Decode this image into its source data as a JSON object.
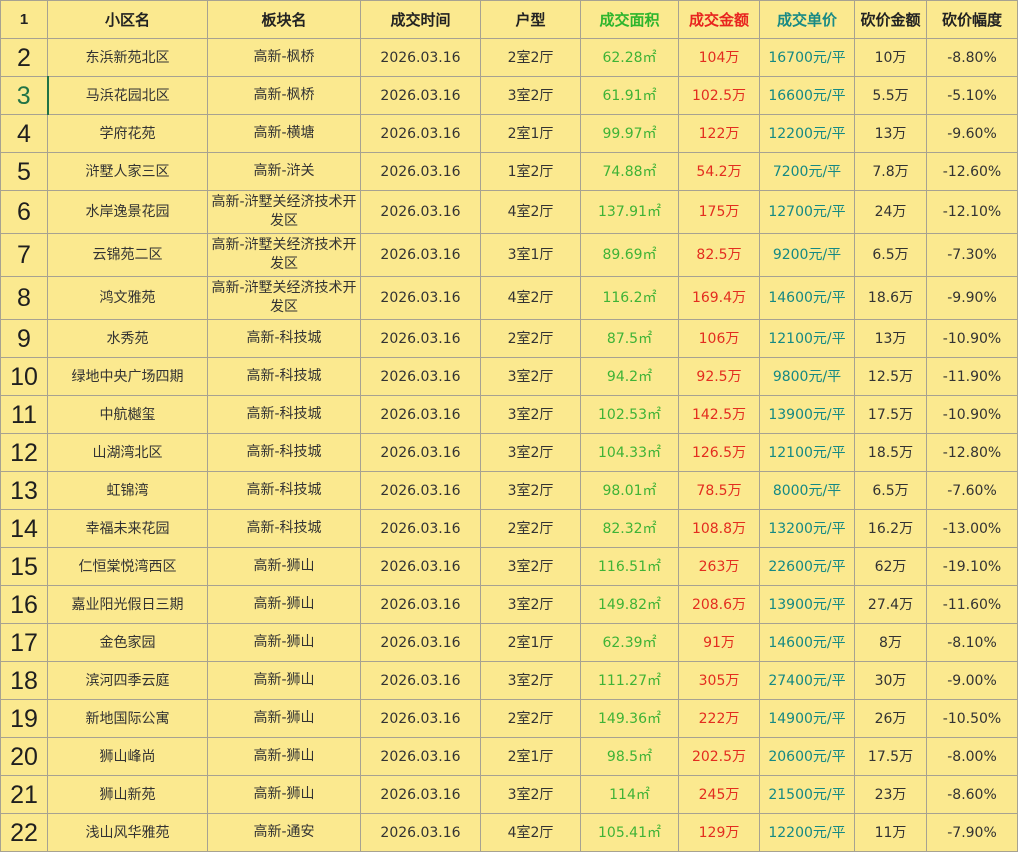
{
  "header": {
    "row_number": "1",
    "cols": [
      "小区名",
      "板块名",
      "成交时间",
      "户型",
      "成交面积",
      "成交金额",
      "成交单价",
      "砍价金额",
      "砍价幅度"
    ]
  },
  "colors": {
    "sheet_bg": "#fbe98f",
    "area_green": "#3fb336",
    "amount_red": "#e32d1f",
    "unit_teal": "#158984",
    "selection_green": "#217346"
  },
  "selected_row": "3",
  "rows": [
    {
      "n": "2",
      "name": "东浜新苑北区",
      "plate": "高新-枫桥",
      "date": "2026.03.16",
      "layout": "2室2厅",
      "area": "62.28㎡",
      "amount": "104万",
      "unit": "16700元/平",
      "cut": "10万",
      "pct": "-8.80%"
    },
    {
      "n": "3",
      "name": "马浜花园北区",
      "plate": "高新-枫桥",
      "date": "2026.03.16",
      "layout": "3室2厅",
      "area": "61.91㎡",
      "amount": "102.5万",
      "unit": "16600元/平",
      "cut": "5.5万",
      "pct": "-5.10%"
    },
    {
      "n": "4",
      "name": "学府花苑",
      "plate": "高新-横塘",
      "date": "2026.03.16",
      "layout": "2室1厅",
      "area": "99.97㎡",
      "amount": "122万",
      "unit": "12200元/平",
      "cut": "13万",
      "pct": "-9.60%"
    },
    {
      "n": "5",
      "name": "浒墅人家三区",
      "plate": "高新-浒关",
      "date": "2026.03.16",
      "layout": "1室2厅",
      "area": "74.88㎡",
      "amount": "54.2万",
      "unit": "7200元/平",
      "cut": "7.8万",
      "pct": "-12.60%"
    },
    {
      "n": "6",
      "name": "水岸逸景花园",
      "plate": "高新-浒墅关经济技术开发区",
      "date": "2026.03.16",
      "layout": "4室2厅",
      "area": "137.91㎡",
      "amount": "175万",
      "unit": "12700元/平",
      "cut": "24万",
      "pct": "-12.10%"
    },
    {
      "n": "7",
      "name": "云锦苑二区",
      "plate": "高新-浒墅关经济技术开发区",
      "date": "2026.03.16",
      "layout": "3室1厅",
      "area": "89.69㎡",
      "amount": "82.5万",
      "unit": "9200元/平",
      "cut": "6.5万",
      "pct": "-7.30%"
    },
    {
      "n": "8",
      "name": "鸿文雅苑",
      "plate": "高新-浒墅关经济技术开发区",
      "date": "2026.03.16",
      "layout": "4室2厅",
      "area": "116.2㎡",
      "amount": "169.4万",
      "unit": "14600元/平",
      "cut": "18.6万",
      "pct": "-9.90%"
    },
    {
      "n": "9",
      "name": "水秀苑",
      "plate": "高新-科技城",
      "date": "2026.03.16",
      "layout": "2室2厅",
      "area": "87.5㎡",
      "amount": "106万",
      "unit": "12100元/平",
      "cut": "13万",
      "pct": "-10.90%"
    },
    {
      "n": "10",
      "name": "绿地中央广场四期",
      "plate": "高新-科技城",
      "date": "2026.03.16",
      "layout": "3室2厅",
      "area": "94.2㎡",
      "amount": "92.5万",
      "unit": "9800元/平",
      "cut": "12.5万",
      "pct": "-11.90%"
    },
    {
      "n": "11",
      "name": "中航樾玺",
      "plate": "高新-科技城",
      "date": "2026.03.16",
      "layout": "3室2厅",
      "area": "102.53㎡",
      "amount": "142.5万",
      "unit": "13900元/平",
      "cut": "17.5万",
      "pct": "-10.90%"
    },
    {
      "n": "12",
      "name": "山湖湾北区",
      "plate": "高新-科技城",
      "date": "2026.03.16",
      "layout": "3室2厅",
      "area": "104.33㎡",
      "amount": "126.5万",
      "unit": "12100元/平",
      "cut": "18.5万",
      "pct": "-12.80%"
    },
    {
      "n": "13",
      "name": "虹锦湾",
      "plate": "高新-科技城",
      "date": "2026.03.16",
      "layout": "3室2厅",
      "area": "98.01㎡",
      "amount": "78.5万",
      "unit": "8000元/平",
      "cut": "6.5万",
      "pct": "-7.60%"
    },
    {
      "n": "14",
      "name": "幸福未来花园",
      "plate": "高新-科技城",
      "date": "2026.03.16",
      "layout": "2室2厅",
      "area": "82.32㎡",
      "amount": "108.8万",
      "unit": "13200元/平",
      "cut": "16.2万",
      "pct": "-13.00%"
    },
    {
      "n": "15",
      "name": "仁恒棠悦湾西区",
      "plate": "高新-狮山",
      "date": "2026.03.16",
      "layout": "3室2厅",
      "area": "116.51㎡",
      "amount": "263万",
      "unit": "22600元/平",
      "cut": "62万",
      "pct": "-19.10%"
    },
    {
      "n": "16",
      "name": "嘉业阳光假日三期",
      "plate": "高新-狮山",
      "date": "2026.03.16",
      "layout": "3室2厅",
      "area": "149.82㎡",
      "amount": "208.6万",
      "unit": "13900元/平",
      "cut": "27.4万",
      "pct": "-11.60%"
    },
    {
      "n": "17",
      "name": "金色家园",
      "plate": "高新-狮山",
      "date": "2026.03.16",
      "layout": "2室1厅",
      "area": "62.39㎡",
      "amount": "91万",
      "unit": "14600元/平",
      "cut": "8万",
      "pct": "-8.10%"
    },
    {
      "n": "18",
      "name": "滨河四季云庭",
      "plate": "高新-狮山",
      "date": "2026.03.16",
      "layout": "3室2厅",
      "area": "111.27㎡",
      "amount": "305万",
      "unit": "27400元/平",
      "cut": "30万",
      "pct": "-9.00%"
    },
    {
      "n": "19",
      "name": "新地国际公寓",
      "plate": "高新-狮山",
      "date": "2026.03.16",
      "layout": "2室2厅",
      "area": "149.36㎡",
      "amount": "222万",
      "unit": "14900元/平",
      "cut": "26万",
      "pct": "-10.50%"
    },
    {
      "n": "20",
      "name": "狮山峰尚",
      "plate": "高新-狮山",
      "date": "2026.03.16",
      "layout": "2室1厅",
      "area": "98.5㎡",
      "amount": "202.5万",
      "unit": "20600元/平",
      "cut": "17.5万",
      "pct": "-8.00%"
    },
    {
      "n": "21",
      "name": "狮山新苑",
      "plate": "高新-狮山",
      "date": "2026.03.16",
      "layout": "3室2厅",
      "area": "114㎡",
      "amount": "245万",
      "unit": "21500元/平",
      "cut": "23万",
      "pct": "-8.60%"
    },
    {
      "n": "22",
      "name": "浅山风华雅苑",
      "plate": "高新-通安",
      "date": "2026.03.16",
      "layout": "4室2厅",
      "area": "105.41㎡",
      "amount": "129万",
      "unit": "12200元/平",
      "cut": "11万",
      "pct": "-7.90%"
    }
  ]
}
